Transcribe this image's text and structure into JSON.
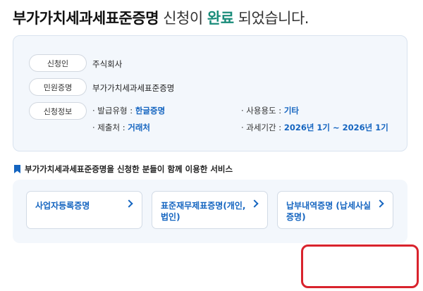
{
  "headline": {
    "strong": "부가가치세과세표준증명",
    "middle": "신청이",
    "accent": "완료",
    "tail": "되었습니다."
  },
  "info": {
    "applicant_label": "신청인",
    "applicant_value": "주식회사",
    "document_label": "민원증명",
    "document_value": "부가가치세과세표준증명",
    "request_label": "신청정보",
    "issue_type_label": "· 발급유형 :",
    "issue_type_value": "한글증명",
    "usage_label": "· 사용용도 :",
    "usage_value": "기타",
    "submit_to_label": "· 제출처 :",
    "submit_to_value": "거래처",
    "tax_period_label": "· 과세기간 :",
    "tax_period_value": "2026년 1기 ~ 2026년 1기"
  },
  "services": {
    "title": "부가가치세과세표준증명을 신청한 분들이 함께 이용한 서비스",
    "items": [
      {
        "label": "사업자등록증명"
      },
      {
        "label": "표준재무제표증명(개인, 법인)"
      },
      {
        "label": "납부내역증명 (납세사실증명)"
      }
    ]
  }
}
